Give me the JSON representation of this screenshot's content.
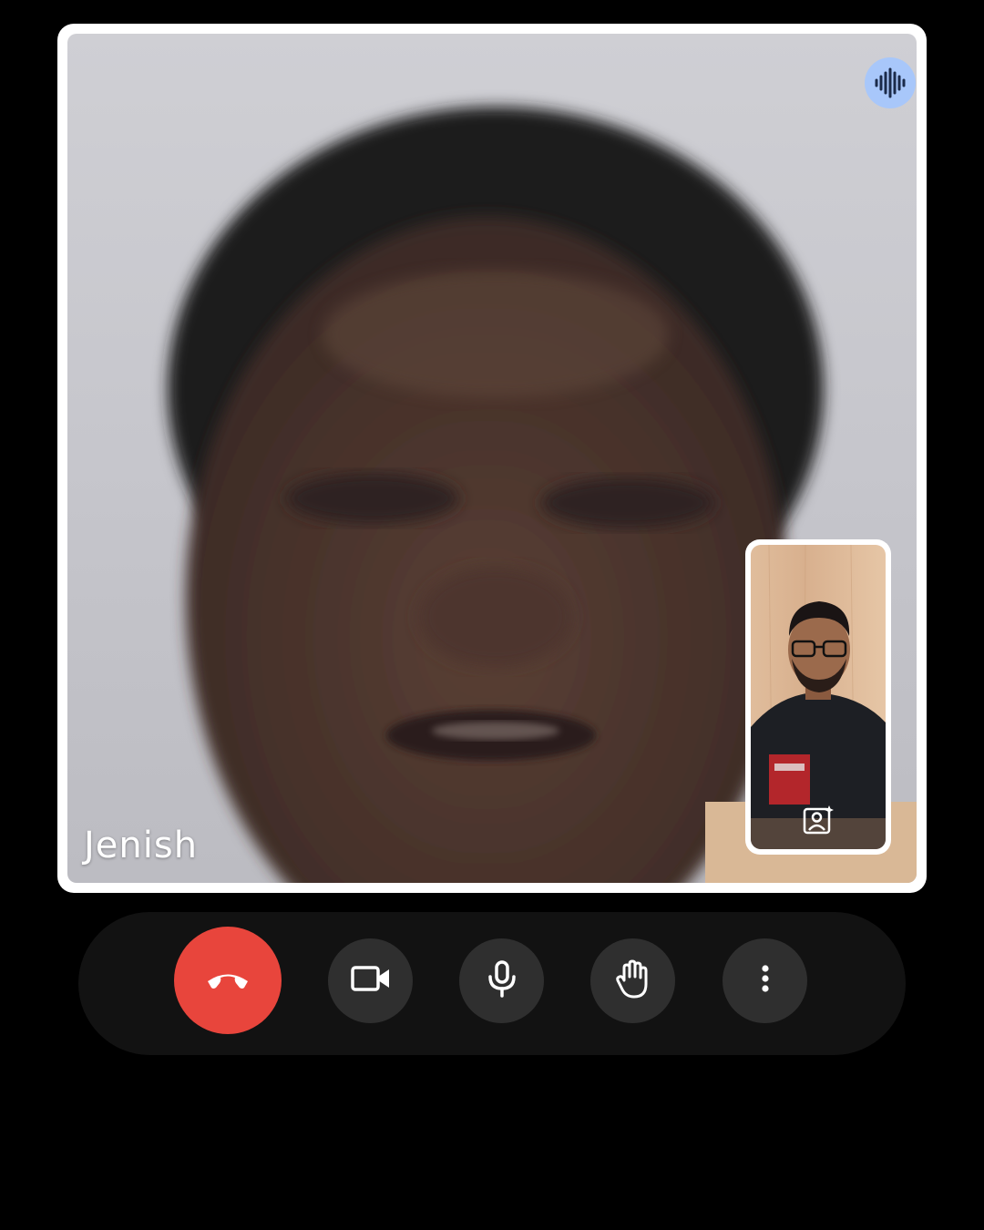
{
  "call": {
    "participant_name": "Jenish"
  },
  "colors": {
    "end_call": "#e8453c",
    "control_button": "#2f2f2f",
    "control_bar": "#121212",
    "audio_indicator": "#a8c7fa",
    "frame_border": "#ffffff"
  },
  "icons": {
    "audio_indicator": "audio-waveform-icon",
    "self_view_effects": "portrait-sparkle-icon",
    "end_call": "phone-hangup-icon",
    "camera": "videocam-icon",
    "microphone": "mic-icon",
    "raise_hand": "hand-icon",
    "more": "more-vert-icon"
  }
}
